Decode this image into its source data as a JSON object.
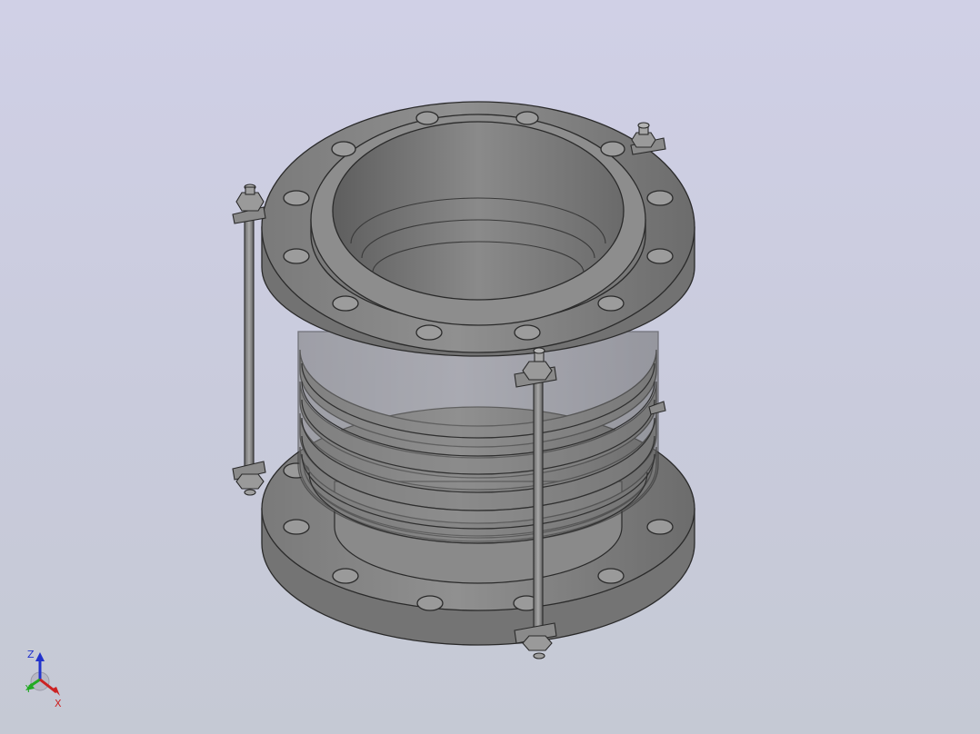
{
  "viewport": {
    "background_top": "#d0d0e6",
    "background_bottom": "#c5c9d4",
    "model_color": "#8c8c8c",
    "edge_color": "#2a2a2a"
  },
  "model": {
    "name": "expansion-joint-with-tie-rods"
  },
  "triad": {
    "z_label": "Z",
    "y_label": "Y",
    "x_label": "X",
    "z_color": "#2233cc",
    "y_color": "#22aa22",
    "x_color": "#cc2222"
  }
}
